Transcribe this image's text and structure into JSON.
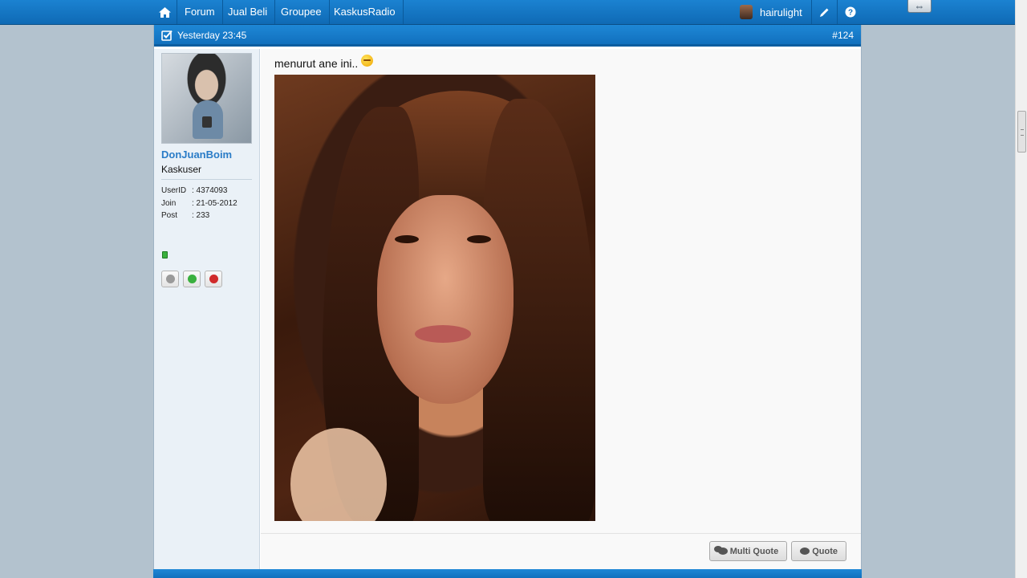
{
  "nav": {
    "items": [
      {
        "label": "Forum"
      },
      {
        "label": "Jual Beli"
      },
      {
        "label": "Groupee"
      },
      {
        "label": "KaskusRadio"
      }
    ],
    "username": "hairulight"
  },
  "post": {
    "date": "Yesterday 23:45",
    "number": "#124",
    "author": {
      "name": "DonJuanBoim",
      "title": "Kaskuser",
      "stats": [
        {
          "key": "UserID",
          "value": ": 4374093"
        },
        {
          "key": "Join",
          "value": ": 21-05-2012"
        },
        {
          "key": "Post",
          "value": ": 233"
        }
      ],
      "online": true
    },
    "message": "menurut ane ini..",
    "buttons": {
      "multi_quote": "Multi Quote",
      "quote": "Quote"
    }
  },
  "colors": {
    "nav_bg": "#1178c6",
    "username": "#2a7cc7",
    "online": "#3ab03e"
  }
}
